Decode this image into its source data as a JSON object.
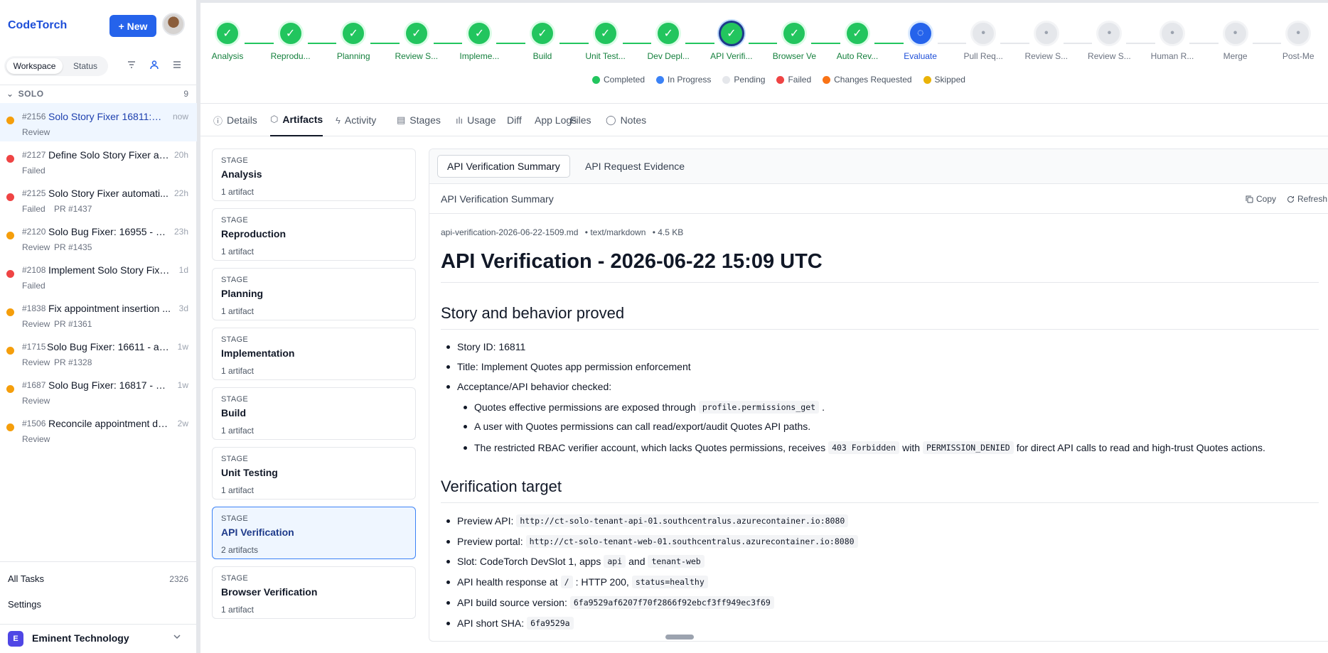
{
  "sidebar": {
    "brand": "CodeTorch",
    "new_label": "+ New",
    "segment": {
      "workspace": "Workspace",
      "status": "Status"
    },
    "section": {
      "label": "SOLO",
      "count": "9"
    },
    "tasks": [
      {
        "num": "#2156",
        "title": "Solo Story Fixer 16811: I...",
        "time": "now",
        "status": "Review",
        "pr": "",
        "color": "#f59e0b"
      },
      {
        "num": "#2127",
        "title": "Define Solo Story Fixer au...",
        "time": "20h",
        "status": "Failed",
        "pr": "",
        "color": "#ef4444"
      },
      {
        "num": "#2125",
        "title": "Solo Story Fixer automati...",
        "time": "22h",
        "status": "Failed",
        "pr": "PR #1437",
        "color": "#ef4444"
      },
      {
        "num": "#2120",
        "title": "Solo Bug Fixer: 16955 - N...",
        "time": "23h",
        "status": "Review",
        "pr": "PR #1435",
        "color": "#f59e0b"
      },
      {
        "num": "#2108",
        "title": "Implement Solo Story Fixe...",
        "time": "1d",
        "status": "Failed",
        "pr": "",
        "color": "#ef4444"
      },
      {
        "num": "#1838",
        "title": "Fix appointment insertion ...",
        "time": "3d",
        "status": "Review",
        "pr": "PR #1361",
        "color": "#f59e0b"
      },
      {
        "num": "#1715",
        "title": "Solo Bug Fixer: 16611 - ap...",
        "time": "1w",
        "status": "Review",
        "pr": "PR #1328",
        "color": "#f59e0b"
      },
      {
        "num": "#1687",
        "title": "Solo Bug Fixer: 16817 - Un...",
        "time": "1w",
        "status": "Review",
        "pr": "",
        "color": "#f59e0b"
      },
      {
        "num": "#1506",
        "title": "Reconcile appointment du...",
        "time": "2w",
        "status": "Review",
        "pr": "",
        "color": "#f59e0b"
      }
    ],
    "footer": {
      "all_tasks": "All Tasks",
      "all_count": "2326",
      "settings": "Settings"
    },
    "org": {
      "initial": "E",
      "name": "Eminent Technology"
    }
  },
  "pipeline": {
    "stages": [
      {
        "label": "Analysis",
        "state": "completed"
      },
      {
        "label": "Reprodu...",
        "state": "completed"
      },
      {
        "label": "Planning",
        "state": "completed"
      },
      {
        "label": "Review S...",
        "state": "completed"
      },
      {
        "label": "Impleme...",
        "state": "completed"
      },
      {
        "label": "Build",
        "state": "completed"
      },
      {
        "label": "Unit Test...",
        "state": "completed"
      },
      {
        "label": "Dev Depl...",
        "state": "completed"
      },
      {
        "label": "API Verifi...",
        "state": "current"
      },
      {
        "label": "Browser Ve",
        "state": "completed"
      },
      {
        "label": "Auto Rev...",
        "state": "completed"
      },
      {
        "label": "Evaluate",
        "state": "inprogress"
      },
      {
        "label": "Pull Req...",
        "state": "pending"
      },
      {
        "label": "Review S...",
        "state": "pending"
      },
      {
        "label": "Review S...",
        "state": "pending"
      },
      {
        "label": "Human R...",
        "state": "pending"
      },
      {
        "label": "Merge",
        "state": "pending"
      },
      {
        "label": "Post-Me",
        "state": "pending"
      }
    ],
    "legend": [
      {
        "label": "Completed",
        "color": "#22c55e"
      },
      {
        "label": "In Progress",
        "color": "#3b82f6"
      },
      {
        "label": "Pending",
        "color": "#e5e7eb"
      },
      {
        "label": "Failed",
        "color": "#ef4444"
      },
      {
        "label": "Changes Requested",
        "color": "#f97316"
      },
      {
        "label": "Skipped",
        "color": "#eab308"
      }
    ]
  },
  "tabs": [
    {
      "label": "Details",
      "icon": "info-icon"
    },
    {
      "label": "Artifacts",
      "icon": "cube-icon"
    },
    {
      "label": "Activity",
      "icon": "bolt-icon"
    },
    {
      "label": "Stages",
      "icon": "clipboard-icon"
    },
    {
      "label": "Usage",
      "icon": "bar-chart-icon"
    },
    {
      "label": "Diff",
      "icon": ""
    },
    {
      "label": "App Logs",
      "icon": ""
    },
    {
      "label": "Files",
      "icon": ""
    },
    {
      "label": "Notes",
      "icon": "comment-icon"
    }
  ],
  "stage_list": {
    "kicker": "STAGE",
    "items": [
      {
        "name": "Analysis",
        "count": "1 artifact"
      },
      {
        "name": "Reproduction",
        "count": "1 artifact"
      },
      {
        "name": "Planning",
        "count": "1 artifact"
      },
      {
        "name": "Implementation",
        "count": "1 artifact"
      },
      {
        "name": "Build",
        "count": "1 artifact"
      },
      {
        "name": "Unit Testing",
        "count": "1 artifact"
      },
      {
        "name": "API Verification",
        "count": "2 artifacts"
      },
      {
        "name": "Browser Verification",
        "count": "1 artifact"
      }
    ]
  },
  "artifact": {
    "tabs": [
      "API Verification Summary",
      "API Request Evidence"
    ],
    "bar_title": "API Verification Summary",
    "copy": "Copy",
    "refresh": "Refresh",
    "meta": {
      "file": "api-verification-2026-06-22-1509.md",
      "type": "• text/markdown",
      "size": "• 4.5 KB"
    },
    "h1": "API Verification - 2026-06-22 15:09 UTC",
    "section1": {
      "heading": "Story and behavior proved",
      "story_id": "Story ID: 16811",
      "title": "Title: Implement Quotes app permission enforcement",
      "checked": "Acceptance/API behavior checked:",
      "sub1_a": "Quotes effective permissions are exposed through",
      "sub1_code": "profile.permissions_get",
      "sub1_b": ".",
      "sub2": "A user with Quotes permissions can call read/export/audit Quotes API paths.",
      "sub3_a": "The restricted RBAC verifier account, which lacks Quotes permissions, receives",
      "sub3_code1": "403 Forbidden",
      "sub3_b": "with",
      "sub3_code2": "PERMISSION_DENIED",
      "sub3_c": "for direct API calls to read and high-trust Quotes actions."
    },
    "section2": {
      "heading": "Verification target",
      "api_label": "Preview API:",
      "api_url": "http://ct-solo-tenant-api-01.southcentralus.azurecontainer.io:8080",
      "portal_label": "Preview portal:",
      "portal_url": "http://ct-solo-tenant-web-01.southcentralus.azurecontainer.io:8080",
      "slot_a": "Slot: CodeTorch DevSlot 1, apps",
      "slot_code1": "api",
      "slot_b": "and",
      "slot_code2": "tenant-web",
      "health_a": "API health response at",
      "health_code1": "/",
      "health_b": ": HTTP 200,",
      "health_code2": "status=healthy",
      "build_label": "API build source version:",
      "build_code": "6fa9529af6207f70f2866f92ebcf3ff949ec3f69",
      "sha_label": "API short SHA:",
      "sha_code": "6fa9529a"
    }
  }
}
